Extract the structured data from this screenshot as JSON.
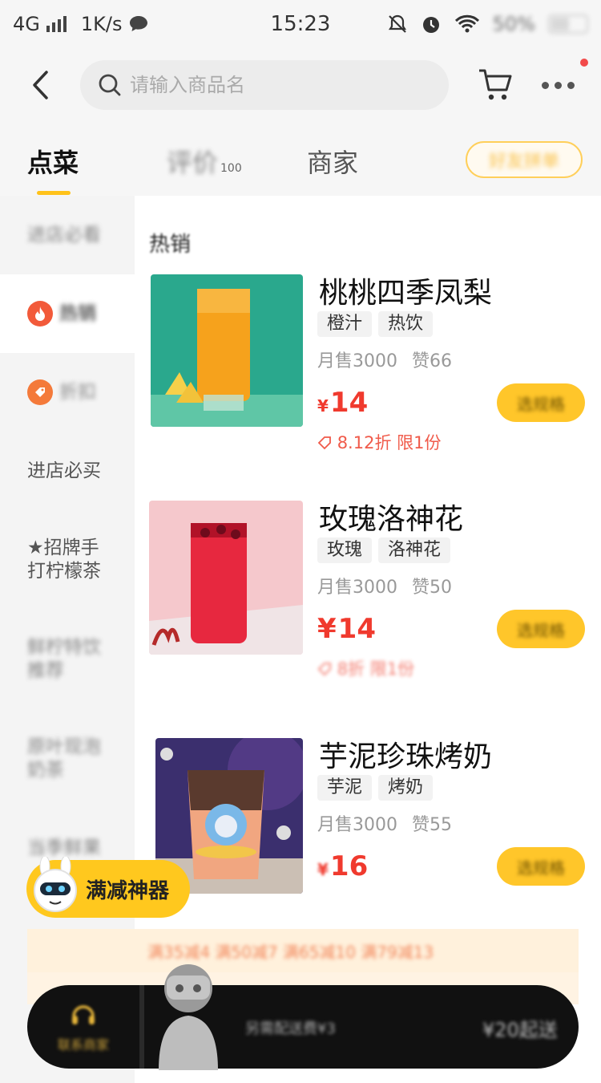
{
  "status_bar": {
    "network": "4G",
    "speed": "1K/s",
    "time": "15:23",
    "battery": "50%"
  },
  "nav": {
    "search_placeholder": "请输入商品名",
    "icons": [
      "back-arrow-icon",
      "search-icon",
      "cart-icon",
      "more-icon"
    ]
  },
  "tabs": {
    "order": "点菜",
    "reviews": "评价",
    "reviews_count": "100",
    "merchant": "商家",
    "group_button": "好友拼单"
  },
  "sidebar": {
    "items": [
      {
        "label": "进店必看"
      },
      {
        "label": "热销",
        "icon": "flame-icon"
      },
      {
        "label": "折扣",
        "icon": "discount-icon"
      },
      {
        "label": "进店必买"
      },
      {
        "label_line1": "★招牌手",
        "label_line2": "打柠檬茶"
      },
      {
        "label_line1": "鲜柠特饮",
        "label_line2": "推荐"
      },
      {
        "label_line1": "原叶现泡",
        "label_line2": "奶茶"
      },
      {
        "label": "当季鲜果"
      }
    ]
  },
  "section_title": "热销",
  "products": [
    {
      "name": "桃桃四季凤梨",
      "tags": [
        "橙汁",
        "热饮"
      ],
      "monthly_sales": "月售3000",
      "likes": "赞66",
      "currency": "¥",
      "price": "14",
      "discount": "8.12折 限1份",
      "button": "选规格"
    },
    {
      "name": "玫瑰洛神花",
      "tags": [
        "玫瑰",
        "洛神花"
      ],
      "monthly_sales": "月售3000",
      "likes": "赞50",
      "currency": "¥",
      "price": "14",
      "discount": "8折 限1份",
      "button": "选规格"
    },
    {
      "name": "芋泥珍珠烤奶",
      "tags": [
        "芋泥",
        "烤奶"
      ],
      "monthly_sales": "月售3000",
      "likes": "赞55",
      "currency": "¥",
      "price": "16",
      "button": "选规格"
    }
  ],
  "badge": "满减神器",
  "promo": "满35减4 满50减7 满65减10 满79减13",
  "bottom_bar": {
    "contact": "联系商家",
    "delivery_fee": "另需配送费¥3",
    "min_order": "¥20起送"
  },
  "colors": {
    "accent_yellow": "#ffc21a",
    "price_red": "#f03a2e",
    "bar_black": "#111111"
  }
}
